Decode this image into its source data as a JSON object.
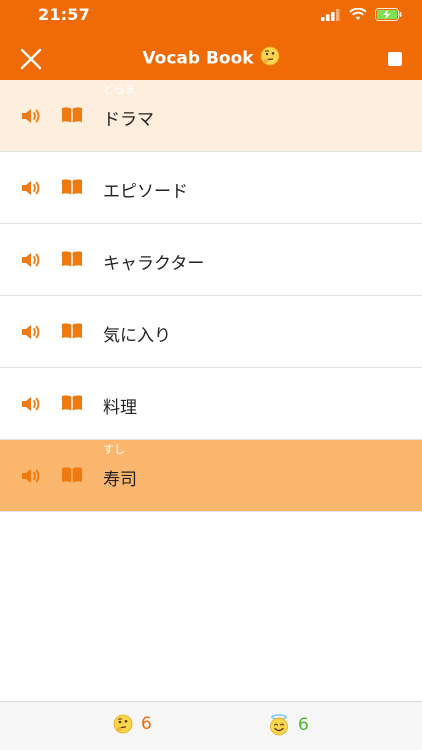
{
  "status_bar": {
    "time": "21:57"
  },
  "header": {
    "title": "Vocab Book",
    "title_emoji": "thinking-face"
  },
  "words": [
    {
      "reading": "どらま",
      "word": "ドラマ",
      "state": "selected"
    },
    {
      "reading": "",
      "word": "エピソード",
      "state": "normal"
    },
    {
      "reading": "",
      "word": "キャラクター",
      "state": "normal"
    },
    {
      "reading": "",
      "word": "気に入り",
      "state": "normal"
    },
    {
      "reading": "",
      "word": "料理",
      "state": "normal"
    },
    {
      "reading": "すし",
      "word": "寿司",
      "state": "highlight"
    }
  ],
  "footer": {
    "thinking_count": "6",
    "halo_count": "6"
  },
  "colors": {
    "brand_orange": "#f06a05",
    "selected_row": "#feeedd",
    "highlight_row": "#fbb66d",
    "green": "#52b331"
  }
}
